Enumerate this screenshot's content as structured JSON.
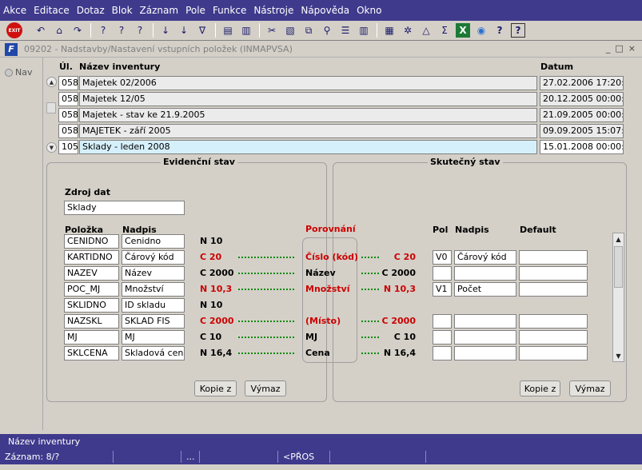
{
  "menu": [
    "Akce",
    "Editace",
    "Dotaz",
    "Blok",
    "Záznam",
    "Pole",
    "Funkce",
    "Nástroje",
    "Nápověda",
    "Okno"
  ],
  "toolbar": {
    "exit_label": "EXIT",
    "icons": [
      "exit-icon",
      "undo-icon",
      "home-icon",
      "redo-icon",
      "enter-query-icon",
      "execute-query-icon",
      "cancel-query-icon",
      "sort-ascending-icon",
      "sort-descending-icon",
      "filter-icon",
      "print-icon",
      "copy-icon",
      "scissors-icon",
      "paste-icon",
      "duplicate-icon",
      "search-icon",
      "list-icon",
      "columns-icon",
      "calculator-icon",
      "tools-icon",
      "chart-icon",
      "sum-icon",
      "excel-icon",
      "globe-icon",
      "help-icon",
      "whats-this-icon"
    ],
    "glyphs": {
      "undo": "↶",
      "home": "⌂",
      "redo": "↷",
      "enter_query": "?",
      "execute_query": "?",
      "cancel_query": "?",
      "sort_asc": "↓",
      "sort_desc": "↓",
      "filter": "∇",
      "print": "▤",
      "copy": "▥",
      "scissors": "✂",
      "paste": "▧",
      "duplicate": "⧉",
      "search": "⚲",
      "list": "☰",
      "columns": "▥",
      "calculator": "▦",
      "tools": "✲",
      "chart": "△",
      "sum": "Σ",
      "excel": "X",
      "globe": "◉",
      "help": "?",
      "whats_this": "?"
    }
  },
  "window": {
    "icon_text": "F",
    "title": "09202 - Nadstavby/Nastavení vstupních položek (INMAPVSA)",
    "controls": [
      "_",
      "□",
      "×"
    ]
  },
  "nav_label": "Nav",
  "inventory": {
    "headers": {
      "ul": "Úl.",
      "name": "Název inventury",
      "date": "Datum"
    },
    "rows": [
      {
        "ul": "058",
        "name": "Majetek 02/2006",
        "date": "27.02.2006 17:20:02"
      },
      {
        "ul": "058",
        "name": "Majetek 12/05",
        "date": "20.12.2005 00:00:00"
      },
      {
        "ul": "058",
        "name": "Majetek - stav ke 21.9.2005",
        "date": "21.09.2005 00:00:00"
      },
      {
        "ul": "058",
        "name": "MAJETEK - září 2005",
        "date": "09.09.2005 15:07:14"
      },
      {
        "ul": "105",
        "name": "Sklady - leden 2008",
        "date": "15.01.2008 00:00:00"
      }
    ],
    "scroll_up": "▲",
    "scroll_down": "▼"
  },
  "evidencni": {
    "title": "Evidenční stav",
    "source_label": "Zdroj dat",
    "source_value": "Sklady",
    "col_item": "Položka",
    "col_caption": "Nadpis",
    "rows": [
      {
        "item": "CENIDNO",
        "caption": "Cenidno",
        "type": "N 10",
        "red": false
      },
      {
        "item": "KARTIDNO",
        "caption": "Čárový kód",
        "type": "C 20",
        "red": true
      },
      {
        "item": "NAZEV",
        "caption": "Název",
        "type": "C 2000",
        "red": false
      },
      {
        "item": "POC_MJ",
        "caption": "Množství",
        "type": "N 10,3",
        "red": true
      },
      {
        "item": "SKLIDNO",
        "caption": "ID skladu",
        "type": "N 10",
        "red": false
      },
      {
        "item": "NAZSKL",
        "caption": "SKLAD FIS",
        "type": "C 2000",
        "red": true
      },
      {
        "item": "MJ",
        "caption": "MJ",
        "type": "C 10",
        "red": false
      },
      {
        "item": "SKLCENA",
        "caption": "Skladová cena",
        "type": "N 16,4",
        "red": false
      }
    ],
    "copy_button": "Kopie z",
    "clear_button": "Výmaz"
  },
  "comparison": {
    "title": "Porovnání",
    "rows": [
      {
        "label": "",
        "red": false
      },
      {
        "label": "Číslo (kód)",
        "red": true
      },
      {
        "label": "Název",
        "red": false
      },
      {
        "label": "Množství",
        "red": true
      },
      {
        "label": "",
        "red": false
      },
      {
        "label": "(Místo)",
        "red": true
      },
      {
        "label": "MJ",
        "red": false
      },
      {
        "label": "Cena",
        "red": false
      }
    ]
  },
  "skutecny": {
    "title": "Skutečný stav",
    "col_pol": "Pol",
    "col_caption": "Nadpis",
    "col_default": "Default",
    "rows": [
      {
        "type": "",
        "red": false,
        "pol": "",
        "caption": "",
        "default": ""
      },
      {
        "type": "C 20",
        "red": true,
        "pol": "V0",
        "caption": "Čárový kód",
        "default": ""
      },
      {
        "type": "C 2000",
        "red": false,
        "pol": "",
        "caption": "",
        "default": ""
      },
      {
        "type": "N 10,3",
        "red": true,
        "pol": "V1",
        "caption": "Počet",
        "default": ""
      },
      {
        "type": "",
        "red": false,
        "pol": "",
        "caption": "",
        "default": ""
      },
      {
        "type": "C 2000",
        "red": true,
        "pol": "",
        "caption": "",
        "default": ""
      },
      {
        "type": "C 10",
        "red": false,
        "pol": "",
        "caption": "",
        "default": ""
      },
      {
        "type": "N 16,4",
        "red": false,
        "pol": "",
        "caption": "",
        "default": ""
      }
    ],
    "copy_button": "Kopie z",
    "clear_button": "Výmaz"
  },
  "hint": "Název inventury",
  "status": {
    "record": "Záznam: 8/?",
    "seg2": "",
    "seg3": "...",
    "seg4": "",
    "seg5": "<PŘOS",
    "seg6": ""
  },
  "colors": {
    "menubar": "#3f3a8c",
    "red": "#cc0000",
    "dots": "#0a8a0a",
    "selected_row": "#d6f0fb"
  }
}
